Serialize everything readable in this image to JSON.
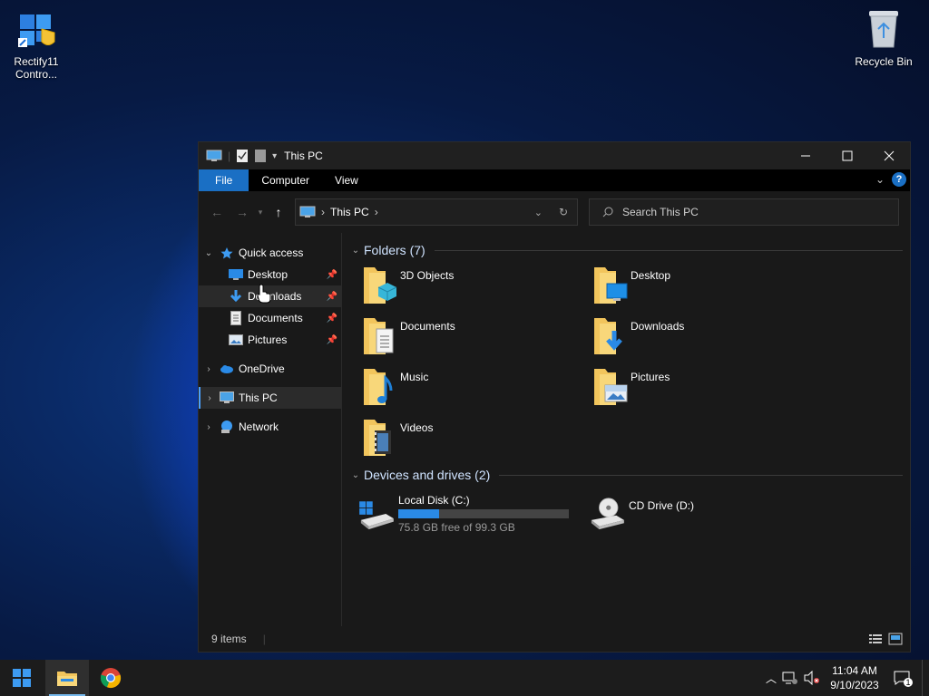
{
  "desktop": {
    "icons": [
      {
        "label_line1": "Rectify11",
        "label_line2": "Contro..."
      },
      {
        "label_line1": "Recycle Bin"
      }
    ]
  },
  "window": {
    "title": "This PC",
    "ribbon_tabs": [
      "File",
      "Computer",
      "View"
    ],
    "help": "?",
    "address": {
      "location": "This PC"
    },
    "search": {
      "placeholder": "Search This PC"
    }
  },
  "sidebar": {
    "quick_access": "Quick access",
    "quick_items": [
      "Desktop",
      "Downloads",
      "Documents",
      "Pictures"
    ],
    "onedrive": "OneDrive",
    "this_pc": "This PC",
    "network": "Network"
  },
  "content": {
    "folders_header": "Folders (7)",
    "folders": [
      "3D Objects",
      "Desktop",
      "Documents",
      "Downloads",
      "Music",
      "Pictures",
      "Videos"
    ],
    "devices_header": "Devices and drives (2)",
    "drives": [
      {
        "name": "Local Disk (C:)",
        "free_text": "75.8 GB free of 99.3 GB",
        "used_fraction": 0.237
      },
      {
        "name": "CD Drive (D:)"
      }
    ]
  },
  "status": {
    "items": "9 items"
  },
  "taskbar": {
    "time": "11:04 AM",
    "date": "9/10/2023",
    "notification_count": "1"
  },
  "colors": {
    "accent": "#1a6fc4",
    "folder": "#f2c55c",
    "bar_fill": "#2a8ae6"
  }
}
